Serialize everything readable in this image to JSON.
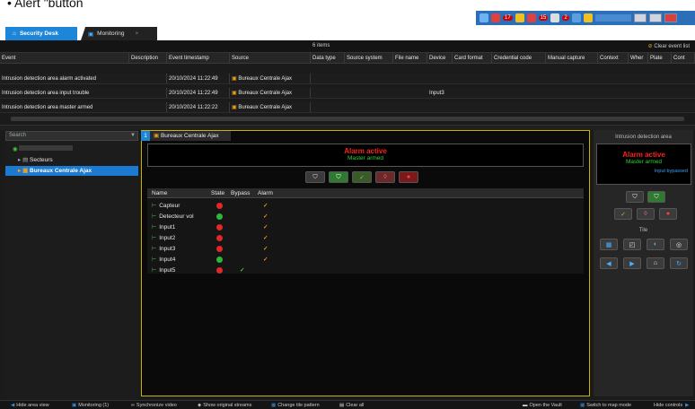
{
  "caption": "• Alert \"button",
  "tray": {
    "badge1": "17",
    "badge2": "15",
    "badge3": "2"
  },
  "tabs": [
    {
      "label": "Security Desk"
    },
    {
      "label": "Monitoring"
    }
  ],
  "events": {
    "count": "6 items",
    "clear_label": "Clear event list",
    "columns": [
      "Event",
      "Description",
      "Event timestamp",
      "Source",
      "Data type",
      "Source system",
      "File name",
      "Device",
      "Card format",
      "Credential code",
      "Manual capture",
      "Context",
      "Wher",
      "Plate",
      "Cont"
    ],
    "rows": [
      {
        "event": "Intrusion detection area alarm activated",
        "timestamp": "20/10/2024 11:22:49",
        "source": "Bureaux Centrale Ajax",
        "device": ""
      },
      {
        "event": "Intrusion detection area input trouble",
        "timestamp": "20/10/2024 11:22:49",
        "source": "Bureaux Centrale Ajax",
        "device": "Input3"
      },
      {
        "event": "Intrusion detection area master armed",
        "timestamp": "20/10/2024 11:22:22",
        "source": "Bureaux Centrale Ajax",
        "device": ""
      }
    ]
  },
  "left": {
    "search_placeholder": "Search",
    "tree": [
      {
        "label": ""
      },
      {
        "label": "Secteurs"
      },
      {
        "label": "Bureaux Centrale Ajax"
      }
    ]
  },
  "tile": {
    "number": "1",
    "tab_label": "Bureaux Centrale Ajax",
    "alarm_text": "Alarm active",
    "arm_text": "Master armed",
    "grid_headers": [
      "Name",
      "State",
      "Bypass",
      "Alarm"
    ],
    "inputs": [
      {
        "name": "Capteur",
        "state": "red",
        "bypass": false,
        "alarm": true
      },
      {
        "name": "Detecteur vol",
        "state": "green",
        "bypass": false,
        "alarm": true
      },
      {
        "name": "Input1",
        "state": "red",
        "bypass": false,
        "alarm": true
      },
      {
        "name": "Input2",
        "state": "red",
        "bypass": false,
        "alarm": true
      },
      {
        "name": "Input3",
        "state": "red",
        "bypass": false,
        "alarm": true
      },
      {
        "name": "Input4",
        "state": "green",
        "bypass": false,
        "alarm": true
      },
      {
        "name": "Input5",
        "state": "red",
        "bypass": true,
        "alarm": false
      }
    ]
  },
  "right": {
    "title": "Intrusion detection area",
    "alarm_text": "Alarm active",
    "arm_text": "Master armed",
    "bypass_text": "Input bypassed",
    "tile_label": "Tile"
  },
  "bottom": {
    "hide_area": "Hide area view",
    "monitoring": "Monitoring (1)",
    "sync": "Synchronize video",
    "original": "Show original streams",
    "pattern": "Change tile pattern",
    "clear": "Clear all",
    "vault": "Open the Vault",
    "map": "Switch to map mode",
    "controls": "Hide controls"
  },
  "colors": {
    "accent": "#1e86d8",
    "alarm": "#ff2020",
    "armed": "#30d040",
    "tile_border": "#c8b400"
  }
}
